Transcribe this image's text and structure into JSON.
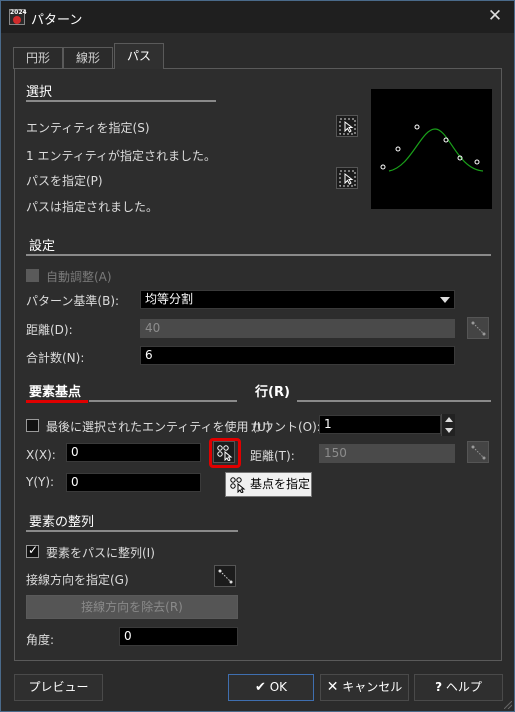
{
  "window": {
    "title": "パターン",
    "app_icon_text": "2024",
    "accent": "#3f6fb0"
  },
  "tabs": [
    {
      "label": "円形",
      "active": false
    },
    {
      "label": "線形",
      "active": false
    },
    {
      "label": "パス",
      "active": true
    }
  ],
  "selection": {
    "heading": "選択",
    "entity_label": "エンティティを指定(S)",
    "entity_status": "1 エンティティが指定されました。",
    "path_label": "パスを指定(P)",
    "path_status": "パスは指定されました。"
  },
  "settings": {
    "heading": "設定",
    "auto_adjust_label": "自動調整(A)",
    "auto_adjust_checked": false,
    "pattern_base_label": "パターン基準(B):",
    "pattern_base_value": "均等分割",
    "distance_label": "距離(D):",
    "distance_value": "40",
    "total_label": "合計数(N):",
    "total_value": "6"
  },
  "base_point": {
    "heading": "要素基点",
    "use_last_label": "最後に選択されたエンティティを使用 (U)",
    "use_last_checked": false,
    "x_label": "X(X):",
    "x_value": "0",
    "y_label": "Y(Y):",
    "y_value": "0",
    "tooltip": "基点を指定"
  },
  "row": {
    "heading": "行(R)",
    "count_label": "カウント(O):",
    "count_value": "1",
    "distance_label": "距離(T):",
    "distance_value": "150"
  },
  "alignment": {
    "heading": "要素の整列",
    "align_label": "要素をパスに整列(I)",
    "align_checked": true,
    "tangent_label": "接線方向を指定(G)",
    "remove_tangent_label": "接線方向を除去(R)",
    "angle_label": "角度:",
    "angle_value": "0"
  },
  "footer": {
    "preview_label": "プレビュー",
    "ok_label": "OK",
    "cancel_label": "キャンセル",
    "help_label": "ヘルプ"
  },
  "icons": [
    "close-icon",
    "select-cursor-icon",
    "pick-point-icon",
    "line-pick-icon",
    "check-icon",
    "x-icon",
    "question-icon",
    "dropdown-arrow-icon",
    "spin-up-icon",
    "spin-down-icon"
  ],
  "colors": {
    "highlight": "#e00000",
    "preview_curve": "#1aa01a",
    "background": "#2b2b2b"
  }
}
